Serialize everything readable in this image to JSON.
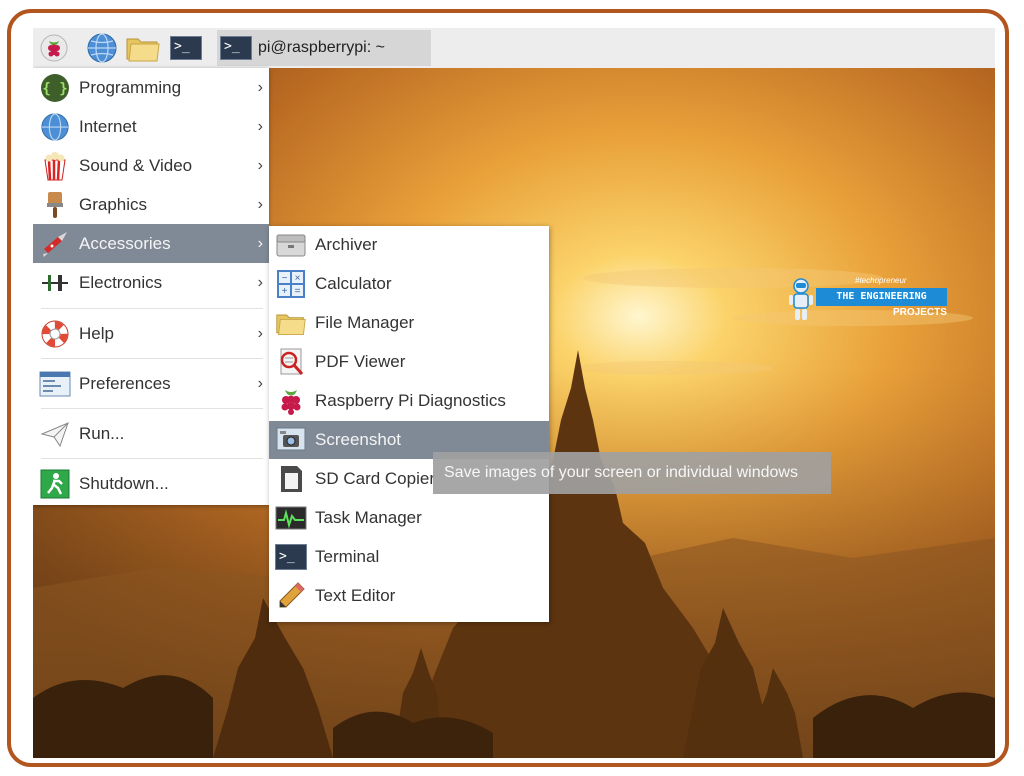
{
  "taskbar": {
    "launcher_icons": [
      "raspberry-icon",
      "globe-icon",
      "folder-icon",
      "terminal-icon"
    ],
    "task_label": "pi@raspberrypi: ~"
  },
  "main_menu": {
    "items": [
      {
        "label": "Programming",
        "icon": "braces-icon",
        "submenu": true
      },
      {
        "label": "Internet",
        "icon": "globe-icon",
        "submenu": true
      },
      {
        "label": "Sound & Video",
        "icon": "popcorn-icon",
        "submenu": true
      },
      {
        "label": "Graphics",
        "icon": "paintbrush-icon",
        "submenu": true
      },
      {
        "label": "Accessories",
        "icon": "pocket-knife-icon",
        "submenu": true,
        "active": true
      },
      {
        "label": "Electronics",
        "icon": "component-icon",
        "submenu": true
      },
      {
        "label": "Help",
        "icon": "lifebuoy-icon",
        "submenu": true
      },
      {
        "label": "Preferences",
        "icon": "preferences-icon",
        "submenu": true
      },
      {
        "label": "Run...",
        "icon": "paper-plane-icon",
        "submenu": false
      },
      {
        "label": "Shutdown...",
        "icon": "exit-icon",
        "submenu": false
      }
    ],
    "arrow": "›"
  },
  "accessories_menu": {
    "items": [
      {
        "label": "Archiver",
        "icon": "archive-icon"
      },
      {
        "label": "Calculator",
        "icon": "calculator-icon"
      },
      {
        "label": "File Manager",
        "icon": "folder-icon"
      },
      {
        "label": "PDF Viewer",
        "icon": "pdf-viewer-icon"
      },
      {
        "label": "Raspberry Pi Diagnostics",
        "icon": "raspberry-icon"
      },
      {
        "label": "Screenshot",
        "icon": "camera-icon",
        "active": true
      },
      {
        "label": "SD Card Copier",
        "icon": "sd-card-icon"
      },
      {
        "label": "Task Manager",
        "icon": "task-manager-icon"
      },
      {
        "label": "Terminal",
        "icon": "terminal-icon"
      },
      {
        "label": "Text Editor",
        "icon": "pencil-icon"
      }
    ]
  },
  "tooltip": {
    "text": "Save images of your screen or individual windows"
  },
  "watermark": {
    "tag": "#techopreneur",
    "title": "THE ENGINEERING",
    "subtitle": "PROJECTS"
  },
  "terminal_glyph": ">_",
  "colors": {
    "frame_border": "#b2551f",
    "menu_highlight": "#808a96",
    "taskbar": "#ededed",
    "watermark_blue": "#1e8bd6"
  }
}
